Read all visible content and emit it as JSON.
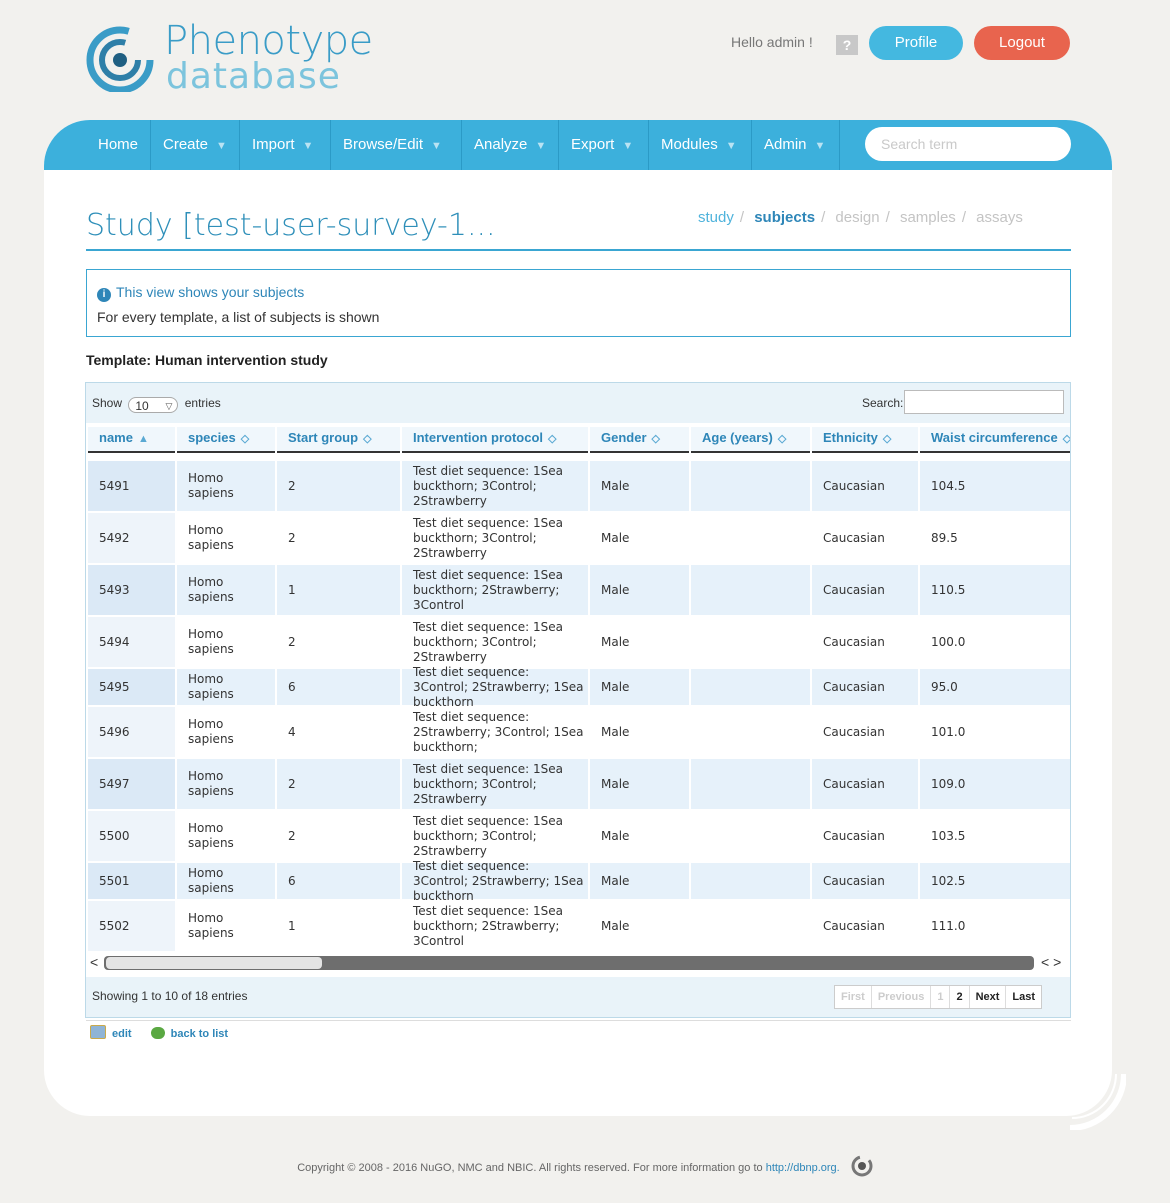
{
  "brand": {
    "line1": "Phenotype",
    "line2": "database"
  },
  "header": {
    "greeting": "Hello admin !",
    "help": "?",
    "profile_label": "Profile",
    "logout_label": "Logout"
  },
  "nav": {
    "items": [
      "Home",
      "Create",
      "Import",
      "Browse/Edit",
      "Analyze",
      "Export",
      "Modules",
      "Admin"
    ],
    "search_placeholder": "Search term"
  },
  "page": {
    "title": "Study [test-user-survey-1...",
    "breadcrumb": [
      "study",
      "subjects",
      "design",
      "samples",
      "assays"
    ],
    "breadcrumb_current": "subjects"
  },
  "info": {
    "heading": "This view shows your subjects",
    "text": "For every template, a list of subjects is shown"
  },
  "template_label": "Template: Human intervention study",
  "table": {
    "show_label": "Show",
    "entries_value": "10",
    "entries_label": "entries",
    "search_label": "Search:",
    "columns": [
      "name",
      "species",
      "Start group",
      "Intervention protocol",
      "Gender",
      "Age (years)",
      "Ethnicity",
      "Waist circumference"
    ],
    "rows": [
      [
        "5491",
        "Homo sapiens",
        "2",
        "Test diet sequence: 1Sea buckthorn; 3Control; 2Strawberry",
        "Male",
        "",
        "Caucasian",
        "104.5"
      ],
      [
        "5492",
        "Homo sapiens",
        "2",
        "Test diet sequence: 1Sea buckthorn; 3Control; 2Strawberry",
        "Male",
        "",
        "Caucasian",
        "89.5"
      ],
      [
        "5493",
        "Homo sapiens",
        "1",
        "Test diet sequence: 1Sea buckthorn; 2Strawberry; 3Control",
        "Male",
        "",
        "Caucasian",
        "110.5"
      ],
      [
        "5494",
        "Homo sapiens",
        "2",
        "Test diet sequence: 1Sea buckthorn; 3Control; 2Strawberry",
        "Male",
        "",
        "Caucasian",
        "100.0"
      ],
      [
        "5495",
        "Homo sapiens",
        "6",
        "Test diet sequence: 3Control; 2Strawberry; 1Sea buckthorn",
        "Male",
        "",
        "Caucasian",
        "95.0"
      ],
      [
        "5496",
        "Homo sapiens",
        "4",
        "Test diet sequence: 2Strawberry; 3Control; 1Sea buckthorn;",
        "Male",
        "",
        "Caucasian",
        "101.0"
      ],
      [
        "5497",
        "Homo sapiens",
        "2",
        "Test diet sequence: 1Sea buckthorn; 3Control; 2Strawberry",
        "Male",
        "",
        "Caucasian",
        "109.0"
      ],
      [
        "5500",
        "Homo sapiens",
        "2",
        "Test diet sequence: 1Sea buckthorn; 3Control; 2Strawberry",
        "Male",
        "",
        "Caucasian",
        "103.5"
      ],
      [
        "5501",
        "Homo sapiens",
        "6",
        "Test diet sequence: 3Control; 2Strawberry; 1Sea buckthorn",
        "Male",
        "",
        "Caucasian",
        "102.5"
      ],
      [
        "5502",
        "Homo sapiens",
        "1",
        "Test diet sequence: 1Sea buckthorn; 2Strawberry; 3Control",
        "Male",
        "",
        "Caucasian",
        "111.0"
      ]
    ],
    "showing": "Showing 1 to 10 of 18 entries",
    "pager": [
      "First",
      "Previous",
      "1",
      "2",
      "Next",
      "Last"
    ]
  },
  "actions": {
    "edit": "edit",
    "back": "back to list"
  },
  "footer": {
    "text": "Copyright © 2008 - 2016 NuGO, NMC and NBIC. All rights reserved. For more information go to",
    "link": "http://dbnp.org."
  },
  "colors": {
    "accent": "#3cb0dc",
    "logout": "#e8644e",
    "title": "#2e8fb9"
  }
}
